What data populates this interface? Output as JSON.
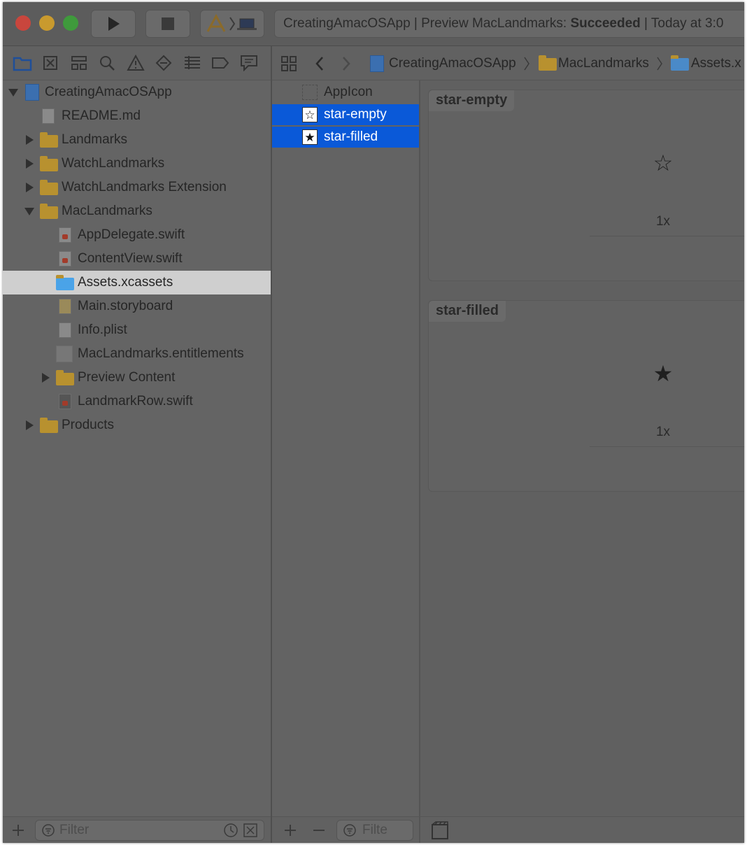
{
  "window": {
    "status": {
      "prefix": "CreatingAmacOSApp | Preview MacLandmarks: ",
      "result": "Succeeded",
      "suffix": " | Today at 3:0"
    },
    "colors": {
      "close": "#c9463d",
      "minimize": "#c99a2e",
      "zoom": "#3f9a3c",
      "selection": "#0a59d8",
      "folder": "#b8912f"
    }
  },
  "toolbar": {
    "run_icon": "play-icon",
    "stop_icon": "stop-icon",
    "scheme_icon": "xcode-app-icon",
    "destination_icon": "laptop-icon"
  },
  "navigator": {
    "tabs": [
      "folder-icon",
      "source-control-icon",
      "hierarchy-icon",
      "search-icon",
      "warning-icon",
      "test-icon",
      "debug-icon",
      "breakpoint-icon",
      "report-icon"
    ],
    "items": [
      {
        "label": "CreatingAmacOSApp"
      },
      {
        "label": "README.md"
      },
      {
        "label": "Landmarks"
      },
      {
        "label": "WatchLandmarks"
      },
      {
        "label": "WatchLandmarks Extension"
      },
      {
        "label": "MacLandmarks"
      },
      {
        "label": "AppDelegate.swift"
      },
      {
        "label": "ContentView.swift"
      },
      {
        "label": "Assets.xcassets"
      },
      {
        "label": "Main.storyboard"
      },
      {
        "label": "Info.plist"
      },
      {
        "label": "MacLandmarks.entitlements"
      },
      {
        "label": "Preview Content"
      },
      {
        "label": "LandmarkRow.swift"
      },
      {
        "label": "Products"
      }
    ],
    "filter_placeholder": "Filter"
  },
  "jumpbar": {
    "crumbs": [
      "CreatingAmacOSApp",
      "MacLandmarks",
      "Assets.x"
    ]
  },
  "assets": {
    "items": [
      {
        "label": "AppIcon"
      },
      {
        "label": "star-empty",
        "glyph": "☆"
      },
      {
        "label": "star-filled",
        "glyph": "★"
      }
    ],
    "filter_placeholder": "Filte"
  },
  "editor": {
    "sets": [
      {
        "title": "star-empty",
        "glyph": "☆",
        "scale": "1x"
      },
      {
        "title": "star-filled",
        "glyph": "★",
        "scale": "1x"
      }
    ]
  }
}
